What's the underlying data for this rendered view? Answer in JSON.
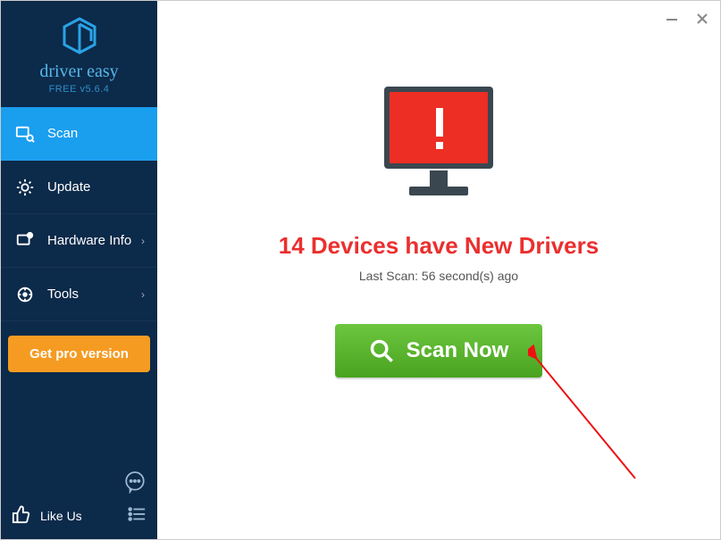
{
  "brand": {
    "name": "driver easy",
    "subtitle": "FREE v5.6.4"
  },
  "sidebar": {
    "items": [
      {
        "label": "Scan"
      },
      {
        "label": "Update"
      },
      {
        "label": "Hardware Info"
      },
      {
        "label": "Tools"
      }
    ],
    "pro_label": "Get pro version",
    "like_label": "Like Us"
  },
  "main": {
    "headline": "14 Devices have New Drivers",
    "last_scan": "Last Scan: 56 second(s) ago",
    "scan_label": "Scan Now"
  },
  "colors": {
    "accent": "#1a9eee",
    "sidebar_bg": "#0c2a4a",
    "danger": "#eb2f2f",
    "scan_btn": "#5cb62f",
    "pro_btn": "#f59b22"
  }
}
